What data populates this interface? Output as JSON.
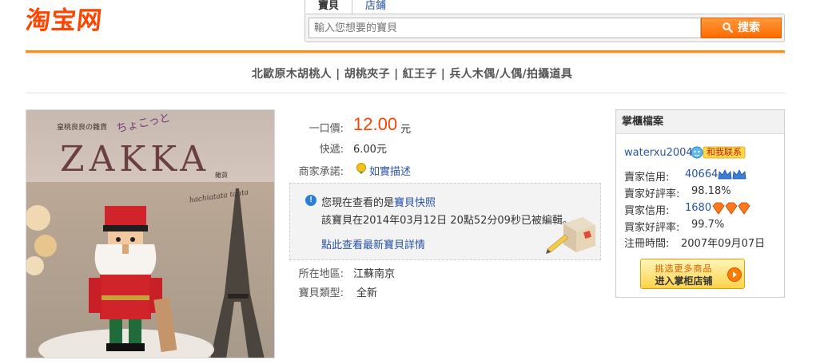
{
  "logo": {
    "text": "淘宝网"
  },
  "search": {
    "tabs": [
      {
        "label": "寶貝",
        "active": true
      },
      {
        "label": "店鋪",
        "active": false
      }
    ],
    "placeholder": "輸入您想要的寶貝",
    "button_label": "搜索"
  },
  "category_line": "北歐原木胡桃人 | 胡桃夾子 | 紅王子 | 兵人木偶/人偶/拍攝道具",
  "product_image": {
    "top_small_text": "皇桃良良の雜貨",
    "japanese_text": "ちょこっと",
    "brand": "ZAKKA",
    "brand_sub": "雜貨",
    "script_text": "hachiatata tanta"
  },
  "price": {
    "label": "一口價:",
    "value": "12.00",
    "unit": "元"
  },
  "shipping": {
    "label": "快遞:",
    "value": "6.00元"
  },
  "promise": {
    "label": "商家承諾:",
    "link": "如實描述"
  },
  "snapshot": {
    "line1_prefix": "您現在查看的是",
    "line1_link": "寶貝快照",
    "line2": "該寶貝在2014年03月12日 20點52分09秒已被編輯。",
    "line3_link": "點此查看最新寶貝詳情"
  },
  "location": {
    "label": "所在地區:",
    "value": "江蘇南京"
  },
  "item_type": {
    "label": "寶貝類型:",
    "value": "全新"
  },
  "seller": {
    "header": "掌櫃檔案",
    "name": "waterxu2004",
    "contact_label": "和我联系",
    "rows": [
      {
        "label": "賣家信用:",
        "value": "40664",
        "badge": "crown-blue"
      },
      {
        "label": "賣家好評率:",
        "value": "98.18%"
      },
      {
        "label": "買家信用:",
        "value": "1680",
        "badge": "diamond"
      },
      {
        "label": "買家好評率:",
        "value": "99.7%"
      },
      {
        "label": "注冊時間:",
        "value": "2007年09月07日"
      }
    ],
    "shop_button_top": "挑选更多商品",
    "shop_button_bottom": "进入掌柜店铺"
  },
  "colors": {
    "accent": "#ff4400",
    "link": "#2953a6",
    "rule": "#ff8c1a"
  }
}
